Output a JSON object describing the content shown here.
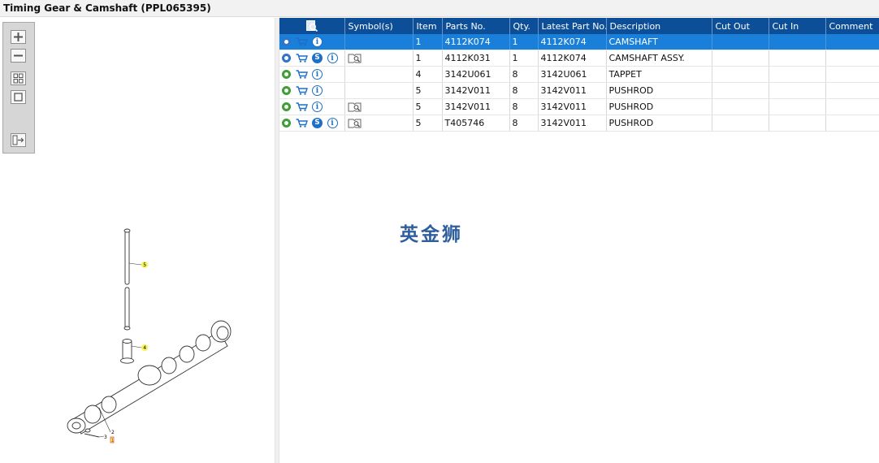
{
  "window": {
    "title": "Timing Gear & Camshaft (PPL065395)"
  },
  "toolbar": {
    "zoom_in_icon": "plus-icon",
    "zoom_out_icon": "minus-icon",
    "fit_icon": "grid-icon",
    "frame_icon": "square-icon",
    "export_icon": "list-arrow-icon"
  },
  "diagram": {
    "callouts": [
      "5",
      "4",
      "3",
      "2",
      "1"
    ],
    "callout_color": "#f5f25b"
  },
  "table": {
    "header_icon": "search-document-icon",
    "columns": [
      "Symbol(s)",
      "Item",
      "Parts No.",
      "Qty.",
      "Latest Part No.",
      "Description",
      "Cut Out",
      "Cut In",
      "Comment"
    ],
    "rows": [
      {
        "gear": "blue",
        "s": false,
        "sym": false,
        "selected": true,
        "item": "1",
        "part_no": "4112K074",
        "qty": "1",
        "latest": "4112K074",
        "desc": "CAMSHAFT",
        "cut_out": "",
        "cut_in": "",
        "comment": ""
      },
      {
        "gear": "blue",
        "s": true,
        "sym": true,
        "selected": false,
        "item": "1",
        "part_no": "4112K031",
        "qty": "1",
        "latest": "4112K074",
        "desc": "CAMSHAFT ASSY.",
        "cut_out": "",
        "cut_in": "",
        "comment": ""
      },
      {
        "gear": "green",
        "s": false,
        "sym": false,
        "selected": false,
        "item": "4",
        "part_no": "3142U061",
        "qty": "8",
        "latest": "3142U061",
        "desc": "TAPPET",
        "cut_out": "",
        "cut_in": "",
        "comment": ""
      },
      {
        "gear": "green",
        "s": false,
        "sym": false,
        "selected": false,
        "item": "5",
        "part_no": "3142V011",
        "qty": "8",
        "latest": "3142V011",
        "desc": "PUSHROD",
        "cut_out": "",
        "cut_in": "",
        "comment": ""
      },
      {
        "gear": "green",
        "s": false,
        "sym": true,
        "selected": false,
        "item": "5",
        "part_no": "3142V011",
        "qty": "8",
        "latest": "3142V011",
        "desc": "PUSHROD",
        "cut_out": "",
        "cut_in": "",
        "comment": ""
      },
      {
        "gear": "green",
        "s": true,
        "sym": true,
        "selected": false,
        "item": "5",
        "part_no": "T405746",
        "qty": "8",
        "latest": "3142V011",
        "desc": "PUSHROD",
        "cut_out": "",
        "cut_in": "",
        "comment": ""
      }
    ]
  },
  "watermark": {
    "text": "英金狮"
  },
  "colors": {
    "header": "#0c4f98",
    "selected_row": "#1a7fd8",
    "gear_green": "#3f9e35",
    "gear_blue": "#2f74c8"
  }
}
